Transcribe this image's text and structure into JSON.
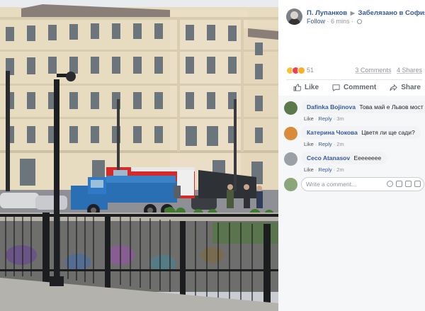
{
  "post": {
    "author": "П. Лупанков",
    "group": "Забелязано в София",
    "follow": "Follow",
    "time": "6 mins"
  },
  "stats": {
    "reaction_count": "51",
    "comments": "3 Comments",
    "shares": "4 Shares"
  },
  "actions": {
    "like": "Like",
    "comment": "Comment",
    "share": "Share"
  },
  "comments": [
    {
      "name": "Dafinka Bojinova",
      "text": "Това май е Львов мост",
      "like": "Like",
      "reply": "Reply",
      "time": "3m"
    },
    {
      "name": "Катерина Чокова",
      "text": "Цветя ли ще сади?",
      "like": "Like",
      "reply": "Reply",
      "time": "2m"
    },
    {
      "name": "Ceco Atanasov",
      "text": "Ееееееее",
      "like": "Like",
      "reply": "Reply",
      "time": "2m"
    }
  ],
  "write_comment": {
    "placeholder": "Write a comment..."
  },
  "colors": {
    "link": "#365899",
    "meta": "#90949c",
    "truck_blue": "#2a6fb4",
    "fire_red": "#d62a2a"
  },
  "icons": [
    "globe-icon",
    "like-icon",
    "comment-icon",
    "share-icon",
    "emoji-icon",
    "camera-icon",
    "gif-icon",
    "sticker-icon"
  ]
}
